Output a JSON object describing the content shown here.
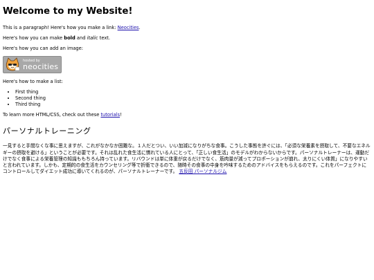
{
  "heading": "Welcome to my Website!",
  "p1": {
    "text": "This is a paragraph! Here's how you make a link: ",
    "link": "Neocities",
    "end": "."
  },
  "p2": {
    "pre": "Here's how you can make ",
    "bold": "bold",
    "mid": " and ",
    "italic": "italic",
    "end": " text."
  },
  "p3": "Here's how you can add an image:",
  "badge": {
    "small": "hosted by",
    "big": "neocities"
  },
  "p4": "Here's how to make a list:",
  "list": [
    "First thing",
    "Second thing",
    "Third thing"
  ],
  "p5": {
    "pre": "To learn more HTML/CSS, check out these ",
    "link": "tutorials",
    "end": "!"
  },
  "section_title": "パーソナルトレーニング",
  "jp_text": "一見すると手間なくな事に思えますが、これがなかなか困難な。１人だとつい、いい加減になりがちな食事。こうした事態を許ぐには、「必須な栄養素を摂取して、不要なエネルギーの摂取を避ける」ということが必要です。それは乱れた食生活に慣れている人にとって、「正しい食生活」のモデルがわからないからです。パーソナルトレーナーは、運動だけでなく食事による栄養管理の知識ももちろん持っています。リバウンドは単に体重が戻るだけでなく、筋肉量が減ってプロポーションが崩れ、太りにくい体質」になりやすいと言われています。しかも、定期的の食生活をカウンセリング等で折衝できるので、随時その食事の中身を吟味するためのアドバイスをもらえるのです。これをパーフェクトにコントロールしてダイエット成功に導いてくれるのが、パーソナルトレーナーです。",
  "jp_link": "五反田 パーソナルジム"
}
